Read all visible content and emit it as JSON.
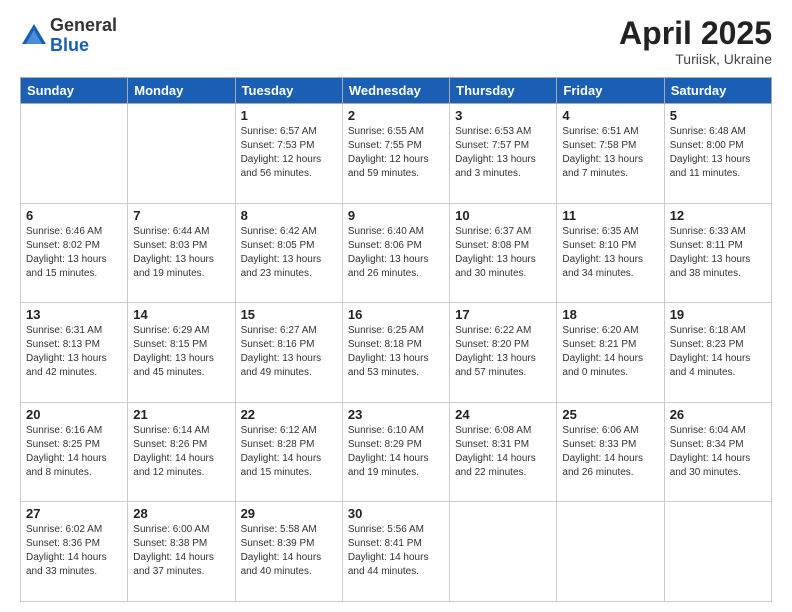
{
  "logo": {
    "general": "General",
    "blue": "Blue"
  },
  "header": {
    "month": "April 2025",
    "location": "Turiisk, Ukraine"
  },
  "weekdays": [
    "Sunday",
    "Monday",
    "Tuesday",
    "Wednesday",
    "Thursday",
    "Friday",
    "Saturday"
  ],
  "weeks": [
    [
      {
        "day": "",
        "info": ""
      },
      {
        "day": "",
        "info": ""
      },
      {
        "day": "1",
        "info": "Sunrise: 6:57 AM\nSunset: 7:53 PM\nDaylight: 12 hours\nand 56 minutes."
      },
      {
        "day": "2",
        "info": "Sunrise: 6:55 AM\nSunset: 7:55 PM\nDaylight: 12 hours\nand 59 minutes."
      },
      {
        "day": "3",
        "info": "Sunrise: 6:53 AM\nSunset: 7:57 PM\nDaylight: 13 hours\nand 3 minutes."
      },
      {
        "day": "4",
        "info": "Sunrise: 6:51 AM\nSunset: 7:58 PM\nDaylight: 13 hours\nand 7 minutes."
      },
      {
        "day": "5",
        "info": "Sunrise: 6:48 AM\nSunset: 8:00 PM\nDaylight: 13 hours\nand 11 minutes."
      }
    ],
    [
      {
        "day": "6",
        "info": "Sunrise: 6:46 AM\nSunset: 8:02 PM\nDaylight: 13 hours\nand 15 minutes."
      },
      {
        "day": "7",
        "info": "Sunrise: 6:44 AM\nSunset: 8:03 PM\nDaylight: 13 hours\nand 19 minutes."
      },
      {
        "day": "8",
        "info": "Sunrise: 6:42 AM\nSunset: 8:05 PM\nDaylight: 13 hours\nand 23 minutes."
      },
      {
        "day": "9",
        "info": "Sunrise: 6:40 AM\nSunset: 8:06 PM\nDaylight: 13 hours\nand 26 minutes."
      },
      {
        "day": "10",
        "info": "Sunrise: 6:37 AM\nSunset: 8:08 PM\nDaylight: 13 hours\nand 30 minutes."
      },
      {
        "day": "11",
        "info": "Sunrise: 6:35 AM\nSunset: 8:10 PM\nDaylight: 13 hours\nand 34 minutes."
      },
      {
        "day": "12",
        "info": "Sunrise: 6:33 AM\nSunset: 8:11 PM\nDaylight: 13 hours\nand 38 minutes."
      }
    ],
    [
      {
        "day": "13",
        "info": "Sunrise: 6:31 AM\nSunset: 8:13 PM\nDaylight: 13 hours\nand 42 minutes."
      },
      {
        "day": "14",
        "info": "Sunrise: 6:29 AM\nSunset: 8:15 PM\nDaylight: 13 hours\nand 45 minutes."
      },
      {
        "day": "15",
        "info": "Sunrise: 6:27 AM\nSunset: 8:16 PM\nDaylight: 13 hours\nand 49 minutes."
      },
      {
        "day": "16",
        "info": "Sunrise: 6:25 AM\nSunset: 8:18 PM\nDaylight: 13 hours\nand 53 minutes."
      },
      {
        "day": "17",
        "info": "Sunrise: 6:22 AM\nSunset: 8:20 PM\nDaylight: 13 hours\nand 57 minutes."
      },
      {
        "day": "18",
        "info": "Sunrise: 6:20 AM\nSunset: 8:21 PM\nDaylight: 14 hours\nand 0 minutes."
      },
      {
        "day": "19",
        "info": "Sunrise: 6:18 AM\nSunset: 8:23 PM\nDaylight: 14 hours\nand 4 minutes."
      }
    ],
    [
      {
        "day": "20",
        "info": "Sunrise: 6:16 AM\nSunset: 8:25 PM\nDaylight: 14 hours\nand 8 minutes."
      },
      {
        "day": "21",
        "info": "Sunrise: 6:14 AM\nSunset: 8:26 PM\nDaylight: 14 hours\nand 12 minutes."
      },
      {
        "day": "22",
        "info": "Sunrise: 6:12 AM\nSunset: 8:28 PM\nDaylight: 14 hours\nand 15 minutes."
      },
      {
        "day": "23",
        "info": "Sunrise: 6:10 AM\nSunset: 8:29 PM\nDaylight: 14 hours\nand 19 minutes."
      },
      {
        "day": "24",
        "info": "Sunrise: 6:08 AM\nSunset: 8:31 PM\nDaylight: 14 hours\nand 22 minutes."
      },
      {
        "day": "25",
        "info": "Sunrise: 6:06 AM\nSunset: 8:33 PM\nDaylight: 14 hours\nand 26 minutes."
      },
      {
        "day": "26",
        "info": "Sunrise: 6:04 AM\nSunset: 8:34 PM\nDaylight: 14 hours\nand 30 minutes."
      }
    ],
    [
      {
        "day": "27",
        "info": "Sunrise: 6:02 AM\nSunset: 8:36 PM\nDaylight: 14 hours\nand 33 minutes."
      },
      {
        "day": "28",
        "info": "Sunrise: 6:00 AM\nSunset: 8:38 PM\nDaylight: 14 hours\nand 37 minutes."
      },
      {
        "day": "29",
        "info": "Sunrise: 5:58 AM\nSunset: 8:39 PM\nDaylight: 14 hours\nand 40 minutes."
      },
      {
        "day": "30",
        "info": "Sunrise: 5:56 AM\nSunset: 8:41 PM\nDaylight: 14 hours\nand 44 minutes."
      },
      {
        "day": "",
        "info": ""
      },
      {
        "day": "",
        "info": ""
      },
      {
        "day": "",
        "info": ""
      }
    ]
  ]
}
